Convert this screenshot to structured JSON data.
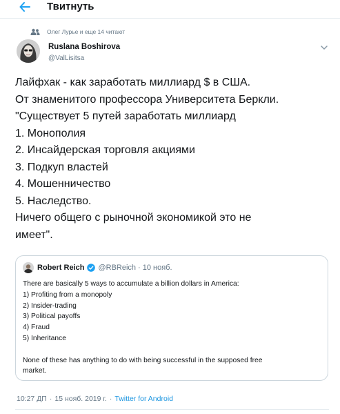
{
  "header": {
    "title": "Твитнуть"
  },
  "social_context": {
    "text": "Олег Лурье и еще 14 читают"
  },
  "author": {
    "name": "Ruslana Boshirova",
    "handle": "@ValLisitsa"
  },
  "tweet": {
    "lines": [
      "Лайфхак - как заработать миллиард $ в США.",
      "От знаменитого профессора Университета Беркли.",
      "\"Существует 5 путей заработать миллиард",
      "1. Монополия",
      "2. Инсайдерская торговля акциями",
      "3. Подкуп властей",
      "4. Мошенничество",
      "5. Наследство.",
      "Ничего общего с рыночной экономикой это не",
      "имеет\"."
    ]
  },
  "quote": {
    "name": "Robert Reich",
    "handle": "@RBReich",
    "separator": "·",
    "date": "10 нояб.",
    "lines": [
      "There are basically 5 ways to accumulate a billion dollars in America:",
      "1) Profiting from a monopoly",
      "2) Insider-trading",
      "3) Political payoffs",
      "4) Fraud",
      "5) Inheritance",
      "",
      "None of these has anything to do with being successful in the supposed free",
      "market."
    ]
  },
  "meta": {
    "time": "10:27 ДП",
    "sep1": "·",
    "date": "15 нояб. 2019 г.",
    "sep2": "·",
    "source": "Twitter for Android"
  },
  "colors": {
    "accent": "#1da1f2",
    "link": "#1b95e0",
    "secondary_text": "#657786",
    "border": "#ccd6dd"
  },
  "icons": {
    "back": "arrow-left-icon",
    "social": "people-icon",
    "caret": "chevron-down-icon",
    "verified": "verified-badge-icon"
  }
}
